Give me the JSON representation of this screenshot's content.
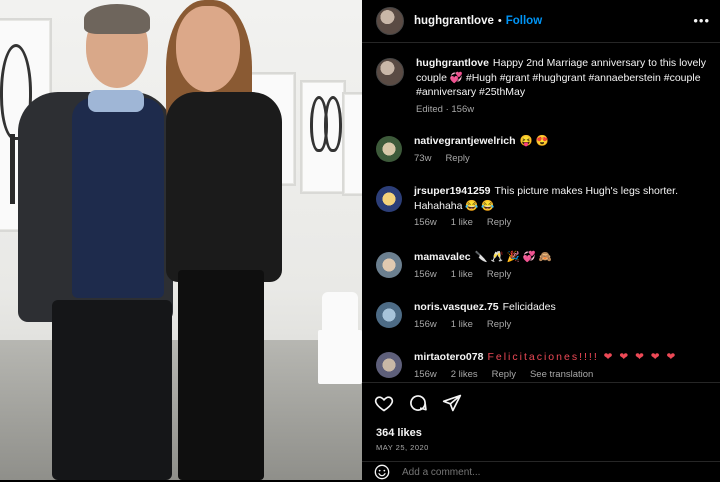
{
  "post": {
    "author": "hughgrantlove",
    "follow_label": "Follow",
    "separator": "•",
    "caption": "Happy 2nd Marriage anniversary to this lovely couple 💞 #Hugh #grant #hughgrant #annaeberstein #couple #anniversary #25thMay",
    "caption_meta": "Edited · 156w"
  },
  "comments": [
    {
      "username": "nativegrantjewelrich",
      "text": "😝 😍",
      "time": "73w",
      "likes": "",
      "reply": "Reply"
    },
    {
      "username": "jrsuper1941259",
      "text": "This picture makes Hugh's legs shorter. Hahahaha 😂 😂",
      "time": "156w",
      "likes": "1 like",
      "reply": "Reply"
    },
    {
      "username": "mamavalec",
      "text": "🔪 🥂 🎉 💞 🙈",
      "time": "156w",
      "likes": "1 like",
      "reply": "Reply"
    },
    {
      "username": "noris.vasquez.75",
      "text": "Felicidades",
      "time": "156w",
      "likes": "1 like",
      "reply": "Reply"
    },
    {
      "username": "mirtaotero078",
      "text": "Felicitaciones!!!! ❤ ❤ ❤ ❤ ❤",
      "time": "156w",
      "likes": "2 likes",
      "reply": "Reply",
      "extra": "See translation"
    }
  ],
  "footer": {
    "likes": "364 likes",
    "date": "MAY 25, 2020",
    "add_comment_placeholder": "Add a comment..."
  },
  "icons": [
    "heart-icon",
    "comment-icon",
    "share-icon",
    "smile-icon",
    "more-icon"
  ],
  "colors": {
    "accent": "#0095f6",
    "background": "#000000",
    "heart": "#ed4956"
  }
}
